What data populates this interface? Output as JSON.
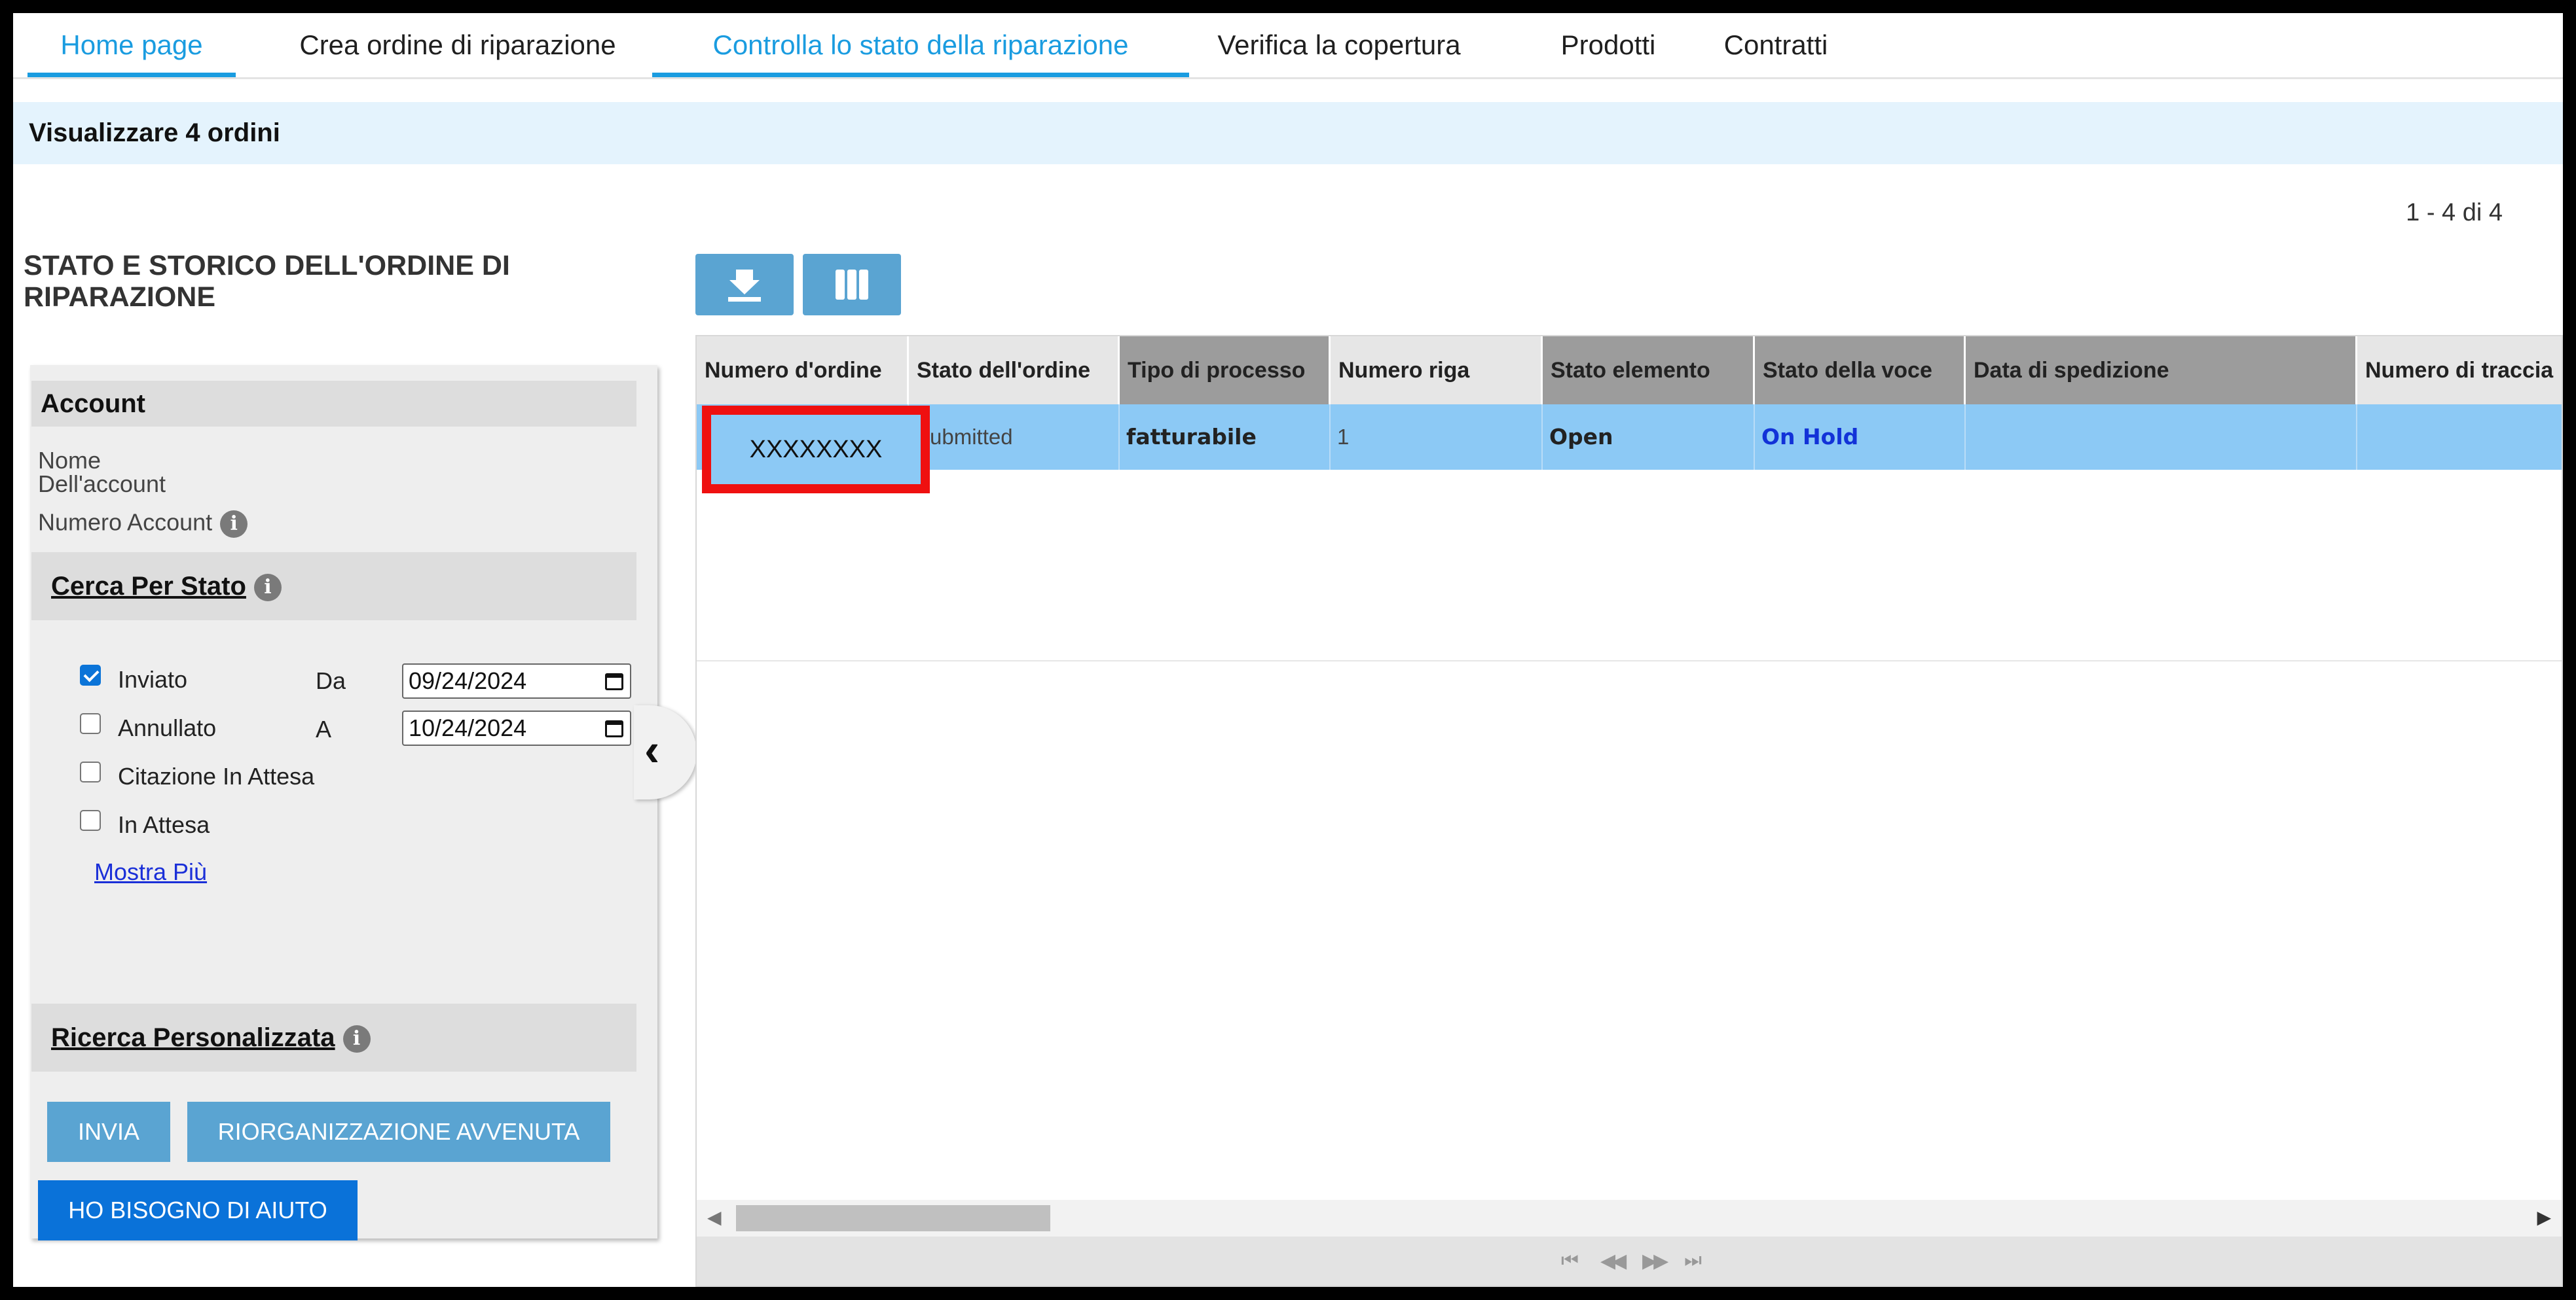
{
  "nav": {
    "tabs": [
      {
        "label": "Home page",
        "active": true
      },
      {
        "label": "Crea ordine di riparazione",
        "active": false
      },
      {
        "label": "Controlla lo stato della riparazione",
        "active": true
      },
      {
        "label": "Verifica la copertura",
        "active": false
      },
      {
        "label": "Prodotti",
        "active": false
      },
      {
        "label": "Contratti",
        "active": false
      }
    ]
  },
  "banner": {
    "text": "Visualizzare 4 ordini"
  },
  "pagination": {
    "range": "1 - 4 di 4"
  },
  "section_title": "STATO E STORICO DELL'ORDINE DI RIPARAZIONE",
  "filter": {
    "account_header": "Account",
    "account_name_label": "Nome Dell'account",
    "account_number_label": "Numero Account",
    "status_header": "Cerca Per Stato",
    "statuses": [
      {
        "label": "Inviato",
        "checked": true
      },
      {
        "label": "Annullato",
        "checked": false
      },
      {
        "label": "Citazione In Attesa",
        "checked": false
      },
      {
        "label": "In Attesa",
        "checked": false
      }
    ],
    "from_label": "Da",
    "from_date": "09/24/2024",
    "to_label": "A",
    "to_date": "10/24/2024",
    "show_more": "Mostra Più",
    "custom_search_header": "Ricerca Personalizzata",
    "submit_button": "INVIA",
    "reset_button": "RIORGANIZZAZIONE AVVENUTA",
    "help_button": "HO BISOGNO DI AIUTO"
  },
  "toolbar": {
    "download_icon": "download-icon",
    "columns_icon": "columns-icon"
  },
  "grid": {
    "columns": [
      "Numero d'ordine",
      "Stato dell'ordine",
      "Tipo di processo",
      "Numero riga",
      "Stato elemento",
      "Stato della voce",
      "Data di spedizione",
      "Numero di traccia"
    ],
    "rows": [
      {
        "order_number": "XXXXXXXX",
        "order_status": "Submitted",
        "process_type": "fatturabile",
        "line_number": "1",
        "item_status": "Open",
        "line_status": "On Hold",
        "ship_date": "",
        "tracking": ""
      }
    ]
  },
  "colors": {
    "accent": "#1a9ce0",
    "selected_row": "#8cc9f5",
    "highlight_border": "#ef1010",
    "help_button": "#0a72d9"
  }
}
